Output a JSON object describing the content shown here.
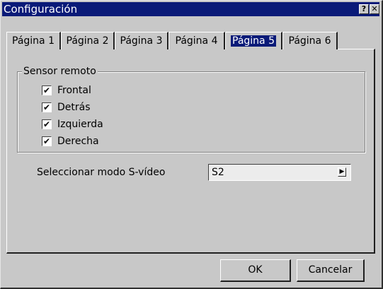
{
  "window": {
    "title": "Configuración",
    "help_glyph": "?",
    "close_glyph": "✕"
  },
  "tabs": [
    {
      "label": "Página 1",
      "active": false
    },
    {
      "label": "Página 2",
      "active": false
    },
    {
      "label": "Página 3",
      "active": false
    },
    {
      "label": "Página 4",
      "active": false
    },
    {
      "label": "Página 5",
      "active": true
    },
    {
      "label": "Página 6",
      "active": false
    }
  ],
  "sensor_group": {
    "label": "Sensor remoto",
    "items": [
      {
        "label": "Frontal",
        "checked": true
      },
      {
        "label": "Detrás",
        "checked": true
      },
      {
        "label": "Izquierda",
        "checked": true
      },
      {
        "label": "Derecha",
        "checked": true
      }
    ],
    "check_glyph": "✔"
  },
  "svideo": {
    "label": "Seleccionar modo S-vídeo",
    "value": "S2",
    "arrow_glyph": "▶"
  },
  "buttons": {
    "ok": "OK",
    "cancel": "Cancelar"
  },
  "colors": {
    "titlebar": "#0a1a78",
    "face": "#c8c8c8"
  }
}
